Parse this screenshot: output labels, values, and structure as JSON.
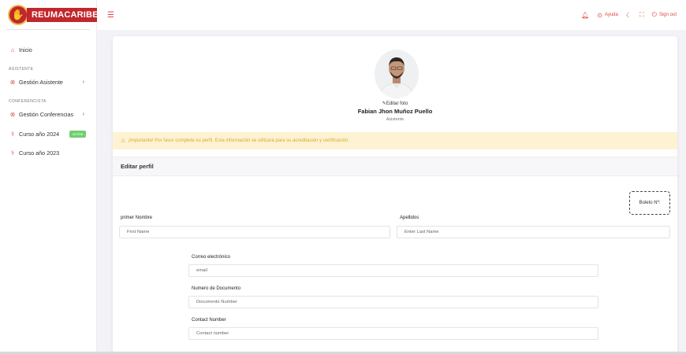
{
  "brand": {
    "name": "REUMACARIBE",
    "primary_color": "#c1272d",
    "accent_color": "#e0463c"
  },
  "topbar": {
    "menu_icon": "hamburger-icon",
    "help_label": "Ayuda",
    "signout_label": "Sign out"
  },
  "sidebar": {
    "home_label": "Inicio",
    "section_asistente": "ASISTENTE",
    "gestion_asistente": "Gestión Asistente",
    "section_conferencista": "CONFERENCISTA",
    "gestion_conferencias": "Gestión Conferencias",
    "curso_2024": "Curso año 2024",
    "curso_2024_badge": "on line",
    "curso_2023": "Curso año 2023"
  },
  "profile": {
    "edit_photo": "Editar foto",
    "name": "Fabian Jhon Muñoz Puello",
    "role": "Asistente"
  },
  "alert": {
    "text": "¡Importante! Por favor complete su perfil. Esta información se utilizará para su acreditación y certificación."
  },
  "form": {
    "section_title": "Editar perfil",
    "boleto_label": "Boleto Nº:",
    "first_name_label": "primer Nombre",
    "first_name_placeholder": "First Name",
    "last_name_label": "Apellidos",
    "last_name_placeholder": "Enter Last Name",
    "email_label": "Correo electrónico",
    "email_placeholder": "email",
    "document_label": "Numero de Documento",
    "document_placeholder": "Documento Number",
    "contact_label": "Contact Number",
    "contact_placeholder": "Contact number"
  }
}
